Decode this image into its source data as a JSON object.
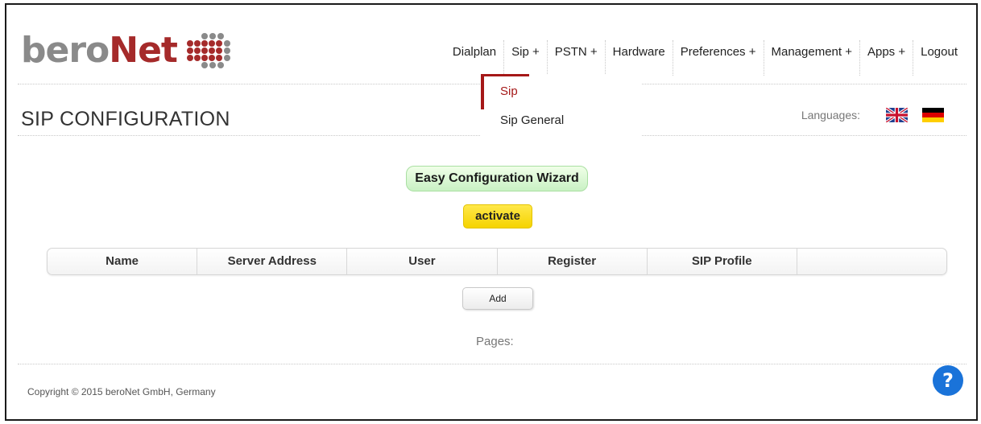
{
  "logo": {
    "part1": "bero",
    "part2": "Net"
  },
  "nav": {
    "items": [
      {
        "label": "Dialplan"
      },
      {
        "label": "Sip +"
      },
      {
        "label": "PSTN +"
      },
      {
        "label": "Hardware"
      },
      {
        "label": "Preferences +"
      },
      {
        "label": "Management +"
      },
      {
        "label": "Apps +"
      },
      {
        "label": "Logout"
      }
    ]
  },
  "dropdown": {
    "items": [
      {
        "label": "Sip",
        "selected": true
      },
      {
        "label": "Sip General",
        "selected": false
      }
    ]
  },
  "page": {
    "title": "SIP CONFIGURATION"
  },
  "languages": {
    "label": "Languages:",
    "flags": [
      "uk-flag-icon",
      "german-flag-icon"
    ]
  },
  "wizard": {
    "button_label": "Easy Configuration Wizard",
    "activate_label": "activate"
  },
  "table": {
    "columns": [
      "Name",
      "Server Address",
      "User",
      "Register",
      "SIP Profile",
      ""
    ]
  },
  "actions": {
    "add_label": "Add"
  },
  "pagination": {
    "label": "Pages:"
  },
  "footer": {
    "copyright": "Copyright © 2015 beroNet GmbH, Germany"
  },
  "help": {
    "icon": "help-icon",
    "label": "?"
  },
  "colors": {
    "brand_red": "#a52a2a",
    "accent_red": "#a51818",
    "brand_gray": "#8a8a8a",
    "wizard_green": "#c9f1c4",
    "activate_yellow": "#f5d300",
    "help_blue": "#1a73d9"
  }
}
